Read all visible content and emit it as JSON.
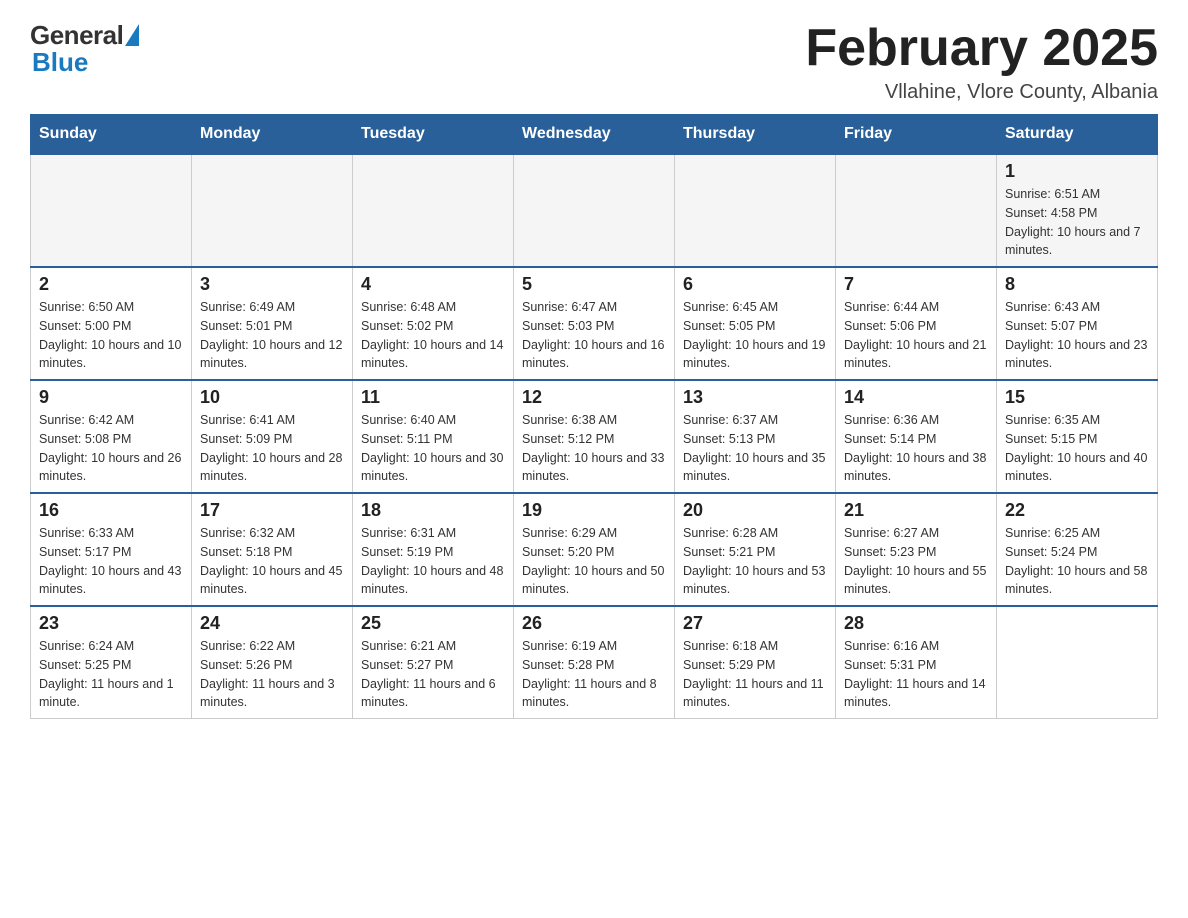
{
  "header": {
    "logo_general": "General",
    "logo_blue": "Blue",
    "month_year": "February 2025",
    "location": "Vllahine, Vlore County, Albania"
  },
  "days_of_week": [
    "Sunday",
    "Monday",
    "Tuesday",
    "Wednesday",
    "Thursday",
    "Friday",
    "Saturday"
  ],
  "weeks": [
    [
      {
        "day": "",
        "info": ""
      },
      {
        "day": "",
        "info": ""
      },
      {
        "day": "",
        "info": ""
      },
      {
        "day": "",
        "info": ""
      },
      {
        "day": "",
        "info": ""
      },
      {
        "day": "",
        "info": ""
      },
      {
        "day": "1",
        "info": "Sunrise: 6:51 AM\nSunset: 4:58 PM\nDaylight: 10 hours and 7 minutes."
      }
    ],
    [
      {
        "day": "2",
        "info": "Sunrise: 6:50 AM\nSunset: 5:00 PM\nDaylight: 10 hours and 10 minutes."
      },
      {
        "day": "3",
        "info": "Sunrise: 6:49 AM\nSunset: 5:01 PM\nDaylight: 10 hours and 12 minutes."
      },
      {
        "day": "4",
        "info": "Sunrise: 6:48 AM\nSunset: 5:02 PM\nDaylight: 10 hours and 14 minutes."
      },
      {
        "day": "5",
        "info": "Sunrise: 6:47 AM\nSunset: 5:03 PM\nDaylight: 10 hours and 16 minutes."
      },
      {
        "day": "6",
        "info": "Sunrise: 6:45 AM\nSunset: 5:05 PM\nDaylight: 10 hours and 19 minutes."
      },
      {
        "day": "7",
        "info": "Sunrise: 6:44 AM\nSunset: 5:06 PM\nDaylight: 10 hours and 21 minutes."
      },
      {
        "day": "8",
        "info": "Sunrise: 6:43 AM\nSunset: 5:07 PM\nDaylight: 10 hours and 23 minutes."
      }
    ],
    [
      {
        "day": "9",
        "info": "Sunrise: 6:42 AM\nSunset: 5:08 PM\nDaylight: 10 hours and 26 minutes."
      },
      {
        "day": "10",
        "info": "Sunrise: 6:41 AM\nSunset: 5:09 PM\nDaylight: 10 hours and 28 minutes."
      },
      {
        "day": "11",
        "info": "Sunrise: 6:40 AM\nSunset: 5:11 PM\nDaylight: 10 hours and 30 minutes."
      },
      {
        "day": "12",
        "info": "Sunrise: 6:38 AM\nSunset: 5:12 PM\nDaylight: 10 hours and 33 minutes."
      },
      {
        "day": "13",
        "info": "Sunrise: 6:37 AM\nSunset: 5:13 PM\nDaylight: 10 hours and 35 minutes."
      },
      {
        "day": "14",
        "info": "Sunrise: 6:36 AM\nSunset: 5:14 PM\nDaylight: 10 hours and 38 minutes."
      },
      {
        "day": "15",
        "info": "Sunrise: 6:35 AM\nSunset: 5:15 PM\nDaylight: 10 hours and 40 minutes."
      }
    ],
    [
      {
        "day": "16",
        "info": "Sunrise: 6:33 AM\nSunset: 5:17 PM\nDaylight: 10 hours and 43 minutes."
      },
      {
        "day": "17",
        "info": "Sunrise: 6:32 AM\nSunset: 5:18 PM\nDaylight: 10 hours and 45 minutes."
      },
      {
        "day": "18",
        "info": "Sunrise: 6:31 AM\nSunset: 5:19 PM\nDaylight: 10 hours and 48 minutes."
      },
      {
        "day": "19",
        "info": "Sunrise: 6:29 AM\nSunset: 5:20 PM\nDaylight: 10 hours and 50 minutes."
      },
      {
        "day": "20",
        "info": "Sunrise: 6:28 AM\nSunset: 5:21 PM\nDaylight: 10 hours and 53 minutes."
      },
      {
        "day": "21",
        "info": "Sunrise: 6:27 AM\nSunset: 5:23 PM\nDaylight: 10 hours and 55 minutes."
      },
      {
        "day": "22",
        "info": "Sunrise: 6:25 AM\nSunset: 5:24 PM\nDaylight: 10 hours and 58 minutes."
      }
    ],
    [
      {
        "day": "23",
        "info": "Sunrise: 6:24 AM\nSunset: 5:25 PM\nDaylight: 11 hours and 1 minute."
      },
      {
        "day": "24",
        "info": "Sunrise: 6:22 AM\nSunset: 5:26 PM\nDaylight: 11 hours and 3 minutes."
      },
      {
        "day": "25",
        "info": "Sunrise: 6:21 AM\nSunset: 5:27 PM\nDaylight: 11 hours and 6 minutes."
      },
      {
        "day": "26",
        "info": "Sunrise: 6:19 AM\nSunset: 5:28 PM\nDaylight: 11 hours and 8 minutes."
      },
      {
        "day": "27",
        "info": "Sunrise: 6:18 AM\nSunset: 5:29 PM\nDaylight: 11 hours and 11 minutes."
      },
      {
        "day": "28",
        "info": "Sunrise: 6:16 AM\nSunset: 5:31 PM\nDaylight: 11 hours and 14 minutes."
      },
      {
        "day": "",
        "info": ""
      }
    ]
  ]
}
